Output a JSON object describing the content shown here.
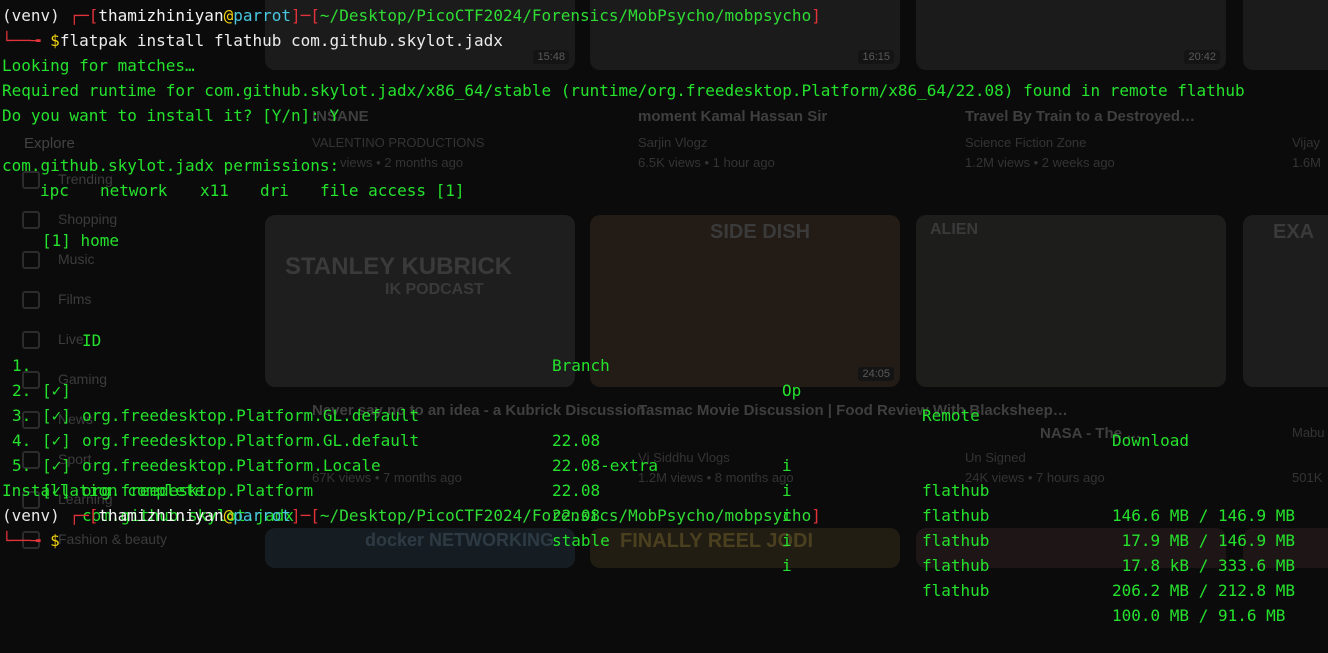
{
  "background": {
    "sidebar": {
      "explore_label": "Explore",
      "items": [
        "Trending",
        "Shopping",
        "Music",
        "Films",
        "Live",
        "Gaming",
        "News",
        "Sport",
        "Learning",
        "Fashion & beauty"
      ]
    },
    "videos": [
      {
        "title": "INSANE",
        "channel": "VALENTINO PRODUCTIONS",
        "meta": "views • 2 months ago",
        "duration": "15:48"
      },
      {
        "title": "moment Kamal Hassan Sir",
        "channel": "Sarjin Vlogz",
        "meta": "6.5K views • 1 hour ago",
        "duration": "16:15"
      },
      {
        "title": "Travel By Train to a Destroyed…",
        "channel": "Science Fiction Zone",
        "meta": "1.2M views • 2 weeks ago",
        "duration": "20:42"
      },
      {
        "title": "Never say no to an idea - a Kubrick Discussion",
        "channel": "",
        "meta": "67K views • 7 months ago",
        "duration": "",
        "thumb_text": "STANLEY KUBRICK",
        "thumb_sub": "IK PODCAST"
      },
      {
        "title": "Tasmac Movie Discussion | Food Review With Blacksheep…",
        "channel": "Vj Siddhu Vlogs",
        "meta": "1.2M views • 8 months ago",
        "duration": "24:05",
        "thumb_text": "SIDE DISH"
      },
      {
        "title": "NASA - The …",
        "channel": "Un Signed",
        "meta": "24K views • 7 hours ago",
        "duration": "",
        "thumb_text": "ALIEN"
      },
      {
        "title": "",
        "channel": "Vijay",
        "meta": "1.6M",
        "duration": ""
      },
      {
        "title": "Mabu",
        "channel": "Mabu",
        "meta": "501K",
        "duration": "",
        "thumb_text": "EXA"
      },
      {
        "title": "",
        "channel": "",
        "meta": "",
        "duration": "",
        "thumb_text": "docker NETWORKING"
      },
      {
        "title": "",
        "channel": "",
        "meta": "",
        "duration": "",
        "thumb_text": "FINALLY REEL JODI"
      }
    ]
  },
  "terminal": {
    "prompt1": {
      "venv": "(venv)",
      "user": "thamizhiniyan",
      "host": "parrot",
      "path": "~/Desktop/PicoCTF2024/Forensics/MobPsycho/mobpsycho",
      "command": "flatpak install flathub com.github.skylot.jadx"
    },
    "output": [
      "Looking for matches…",
      "Required runtime for com.github.skylot.jadx/x86_64/stable (runtime/org.freedesktop.Platform/x86_64/22.08) found in remote flathub",
      "Do you want to install it? [Y/n]: Y"
    ],
    "permissions_header": "com.github.skylot.jadx permissions:",
    "permissions": [
      "ipc",
      "network",
      "x11",
      "dri",
      "file access [1]"
    ],
    "file_access_note": "[1] home",
    "table": {
      "headers": {
        "id": "ID",
        "branch": "Branch",
        "op": "Op",
        "remote": "Remote",
        "download": "Download"
      },
      "rows": [
        {
          "num": "1.",
          "check": "[✓]",
          "id": "org.freedesktop.Platform.GL.default",
          "branch": "22.08",
          "op": "i",
          "remote": "flathub",
          "download": "146.6 MB / 146.9 MB"
        },
        {
          "num": "2.",
          "check": "[✓]",
          "id": "org.freedesktop.Platform.GL.default",
          "branch": "22.08-extra",
          "op": "i",
          "remote": "flathub",
          "download": " 17.9 MB / 146.9 MB"
        },
        {
          "num": "3.",
          "check": "[✓]",
          "id": "org.freedesktop.Platform.Locale",
          "branch": "22.08",
          "op": "i",
          "remote": "flathub",
          "download": " 17.8 kB / 333.6 MB"
        },
        {
          "num": "4.",
          "check": "[✓]",
          "id": "org.freedesktop.Platform",
          "branch": "22.08",
          "op": "i",
          "remote": "flathub",
          "download": "206.2 MB / 212.8 MB"
        },
        {
          "num": "5.",
          "check": "[✓]",
          "id": "com.github.skylot.jadx",
          "branch": "stable",
          "op": "i",
          "remote": "flathub",
          "download": "100.0 MB / 91.6 MB"
        }
      ]
    },
    "completion": "Installation complete.",
    "prompt2": {
      "venv": "(venv)",
      "user": "thamizhiniyan",
      "host": "parrot",
      "path": "~/Desktop/PicoCTF2024/Forensics/MobPsycho/mobpsycho",
      "command": ""
    },
    "prompt_symbols": {
      "corner_top": "┌─[",
      "bracket_close": "]",
      "dash_open": "─[",
      "corner_bottom": "└──╼ ",
      "dollar": "$",
      "at": "@"
    }
  }
}
